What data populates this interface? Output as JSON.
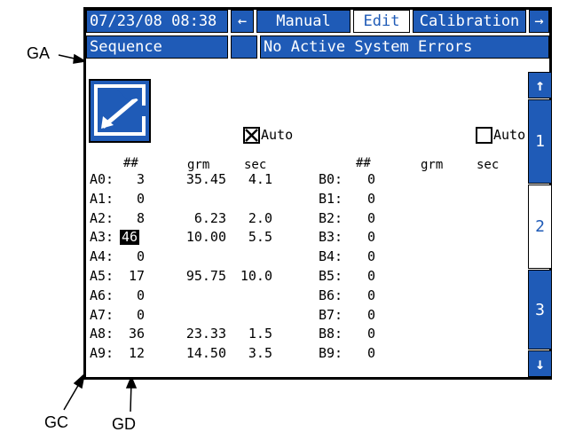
{
  "callouts": {
    "ga": "GA",
    "gc": "GC",
    "gd": "GD"
  },
  "topbar": {
    "datetime": "07/23/08 08:38",
    "tab_manual": "Manual",
    "tab_edit": "Edit",
    "tab_calibration": "Calibration",
    "left_arrow": "←",
    "right_arrow": "→"
  },
  "statusbar": {
    "screen_name": "Sequence",
    "message": "No Active System Errors"
  },
  "auto_a": {
    "label": "Auto",
    "checked": true
  },
  "auto_b": {
    "label": "Auto",
    "checked": false
  },
  "headers": {
    "a": {
      "count": "##",
      "grm": "grm",
      "sec": "sec"
    },
    "b": {
      "count": "##",
      "grm": "grm",
      "sec": "sec"
    }
  },
  "rows_a": [
    {
      "label": "A0:",
      "count": "3",
      "grm": "35.45",
      "sec": "4.1"
    },
    {
      "label": "A1:",
      "count": "0",
      "grm": "",
      "sec": ""
    },
    {
      "label": "A2:",
      "count": "8",
      "grm": "6.23",
      "sec": "2.0"
    },
    {
      "label": "A3:",
      "count": "46",
      "grm": "10.00",
      "sec": "5.5"
    },
    {
      "label": "A4:",
      "count": "0",
      "grm": "",
      "sec": ""
    },
    {
      "label": "A5:",
      "count": "17",
      "grm": "95.75",
      "sec": "10.0"
    },
    {
      "label": "A6:",
      "count": "0",
      "grm": "",
      "sec": ""
    },
    {
      "label": "A7:",
      "count": "0",
      "grm": "",
      "sec": ""
    },
    {
      "label": "A8:",
      "count": "36",
      "grm": "23.33",
      "sec": "1.5"
    },
    {
      "label": "A9:",
      "count": "12",
      "grm": "14.50",
      "sec": "3.5"
    }
  ],
  "rows_b": [
    {
      "label": "B0:",
      "count": "0"
    },
    {
      "label": "B1:",
      "count": "0"
    },
    {
      "label": "B2:",
      "count": "0"
    },
    {
      "label": "B3:",
      "count": "0"
    },
    {
      "label": "B4:",
      "count": "0"
    },
    {
      "label": "B5:",
      "count": "0"
    },
    {
      "label": "B6:",
      "count": "0"
    },
    {
      "label": "B7:",
      "count": "0"
    },
    {
      "label": "B8:",
      "count": "0"
    },
    {
      "label": "B9:",
      "count": "0"
    }
  ],
  "selected_cell": "A3",
  "side_tabs": [
    {
      "label": "1",
      "selected": false
    },
    {
      "label": "2",
      "selected": true
    },
    {
      "label": "3",
      "selected": false
    }
  ],
  "side_arrows": {
    "up": "↑",
    "down": "↓"
  },
  "colors": {
    "accent": "#1f5bb7",
    "text": "#000000",
    "background": "#ffffff"
  }
}
